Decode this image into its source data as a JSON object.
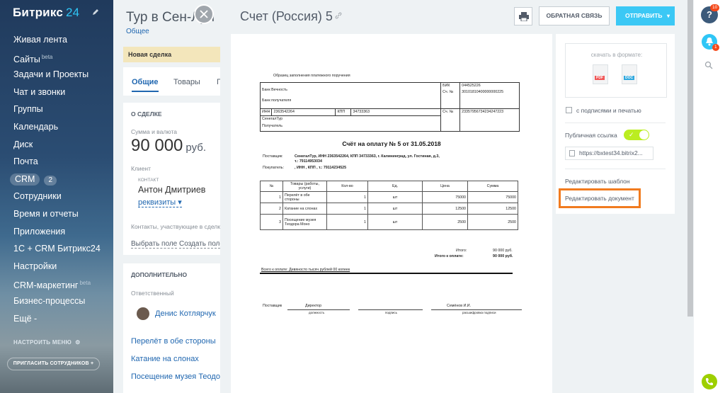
{
  "sidebar": {
    "logo": "Битрикс",
    "logo_num": "24",
    "items": [
      {
        "label": "Живая лента"
      },
      {
        "label": "Сайты",
        "sup": "beta"
      },
      {
        "label": "Задачи и Проекты"
      },
      {
        "label": "Чат и звонки"
      },
      {
        "label": "Группы"
      },
      {
        "label": "Календарь"
      },
      {
        "label": "Диск"
      },
      {
        "label": "Почта"
      },
      {
        "label": "CRM",
        "count": "2"
      },
      {
        "label": "Сотрудники"
      },
      {
        "label": "Время и отчеты"
      },
      {
        "label": "Приложения"
      },
      {
        "label": "1С + CRM Битрикс24"
      },
      {
        "label": "Настройки"
      },
      {
        "label": "CRM-маркетинг",
        "sup": "beta"
      },
      {
        "label": "Бизнес-процессы"
      },
      {
        "label": "Ещё -"
      }
    ],
    "settings": "НАСТРОИТЬ МЕНЮ",
    "invite": "ПРИГЛАСИТЬ СОТРУДНИКОВ"
  },
  "deal": {
    "title": "Тур в Сен-Луи",
    "subtitle": "Общее",
    "stage": "Новая сделка",
    "tabs": [
      "Общие",
      "Товары",
      "Г"
    ],
    "about_head": "О СДЕЛКЕ",
    "sum_label": "Сумма и валюта",
    "sum": "90 000",
    "currency": "руб.",
    "client_label": "Клиент",
    "contact_small": "КОНТАКТ",
    "client_name": "Антон Дмитриев",
    "client_link": "реквизиты",
    "contacts_note": "Контакты, участвующие в сделке",
    "select_field": "Выбрать поле",
    "create_field": "Создать поле",
    "extra_head": "ДОПОЛНИТЕЛЬНО",
    "responsible_label": "Ответственный",
    "responsible": "Денис Котлярчук",
    "links": [
      "Перелёт в обе стороны",
      "Катание на слонах",
      "Посещение музея Теодора Моно"
    ]
  },
  "slider": {
    "title": "Счет (Россия) 5",
    "feedback": "ОБРАТНАЯ СВЯЗЬ",
    "send": "ОТПРАВИТЬ"
  },
  "invoice": {
    "sample": "Образец заполнения платежного поручения",
    "bank": "Банк Вечность",
    "bank_recipient": "Банк получателя",
    "bik_label": "БИК",
    "bik": "044525226",
    "acc_label": "Сч. №",
    "acc1": "30101810400000000225",
    "inn_label": "ИНН",
    "inn": "2363542264",
    "kpp_label": "КПП",
    "kpp": "34733363",
    "acc2": "23357956734234247223",
    "company": "СенегалТур",
    "recipient": "Получатель",
    "title": "Счёт на оплату № 5 от 31.05.2018",
    "supplier_label": "Поставщик:",
    "supplier_line1": "СенегалТур, ИНН 2363542264, КПП 34733363, г. Калининград, ул. Гостиная, д.3,",
    "supplier_line2": "т.: 79114953034",
    "buyer_label": "Покупатель:",
    "buyer": ", ИНН , КПП , т.: 79114234525",
    "headers": [
      "№",
      "Товары (работы, услуги)",
      "Кол-во",
      "Ед.",
      "Цена",
      "Сумма"
    ],
    "rows": [
      [
        "1",
        "Перелёт в обе стороны",
        "1",
        "шт",
        "75000",
        "75000"
      ],
      [
        "2",
        "Катание на слонах",
        "1",
        "шт",
        "12500",
        "12500"
      ],
      [
        "3",
        "Посещение музея Теодора Моно",
        "1",
        "шт",
        "2500",
        "2500"
      ]
    ],
    "total_label": "Итого:",
    "total": "90 000 руб.",
    "payable_label": "Итого к оплате:",
    "payable": "90 000 руб.",
    "in_words": "Всего к оплате: Девяносто тысяч рублей 00 копеек",
    "sig_supplier": "Поставщик",
    "sig_position": "Директор",
    "sig_name": "Семёнов И.И.",
    "cap_position": "должность",
    "cap_sign": "подпись",
    "cap_decode": "расшифровка подписи"
  },
  "options": {
    "download_label": "скачать в формате:",
    "pdf": "PDF",
    "doc": "DOC",
    "with_signatures": "с подписями и печатью",
    "public_link": "Публичная ссылка",
    "url": "https://bxtest34.bitrix2...",
    "edit_template": "Редактировать шаблон",
    "edit_document": "Редактировать документ"
  },
  "rpanel": {
    "help_badge": "10",
    "bell_badge": "1"
  },
  "colors": {
    "accent": "#3bc8f5",
    "highlight": "#f17b1f",
    "toggle": "#bbed21"
  }
}
